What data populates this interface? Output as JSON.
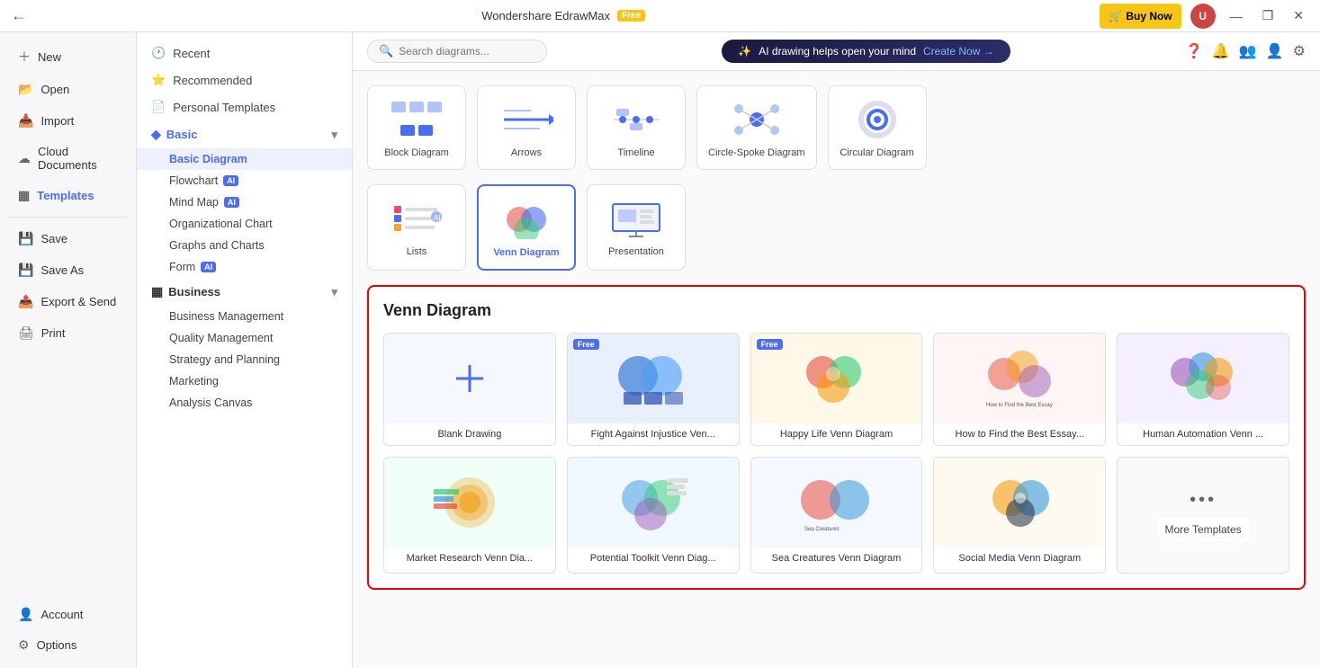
{
  "titlebar": {
    "title": "Wondershare EdrawMax",
    "badge": "Free",
    "buy_now": "Buy Now",
    "controls": [
      "—",
      "❐",
      "✕"
    ]
  },
  "sidebar": {
    "items": [
      {
        "id": "new",
        "label": "New",
        "icon": "＋"
      },
      {
        "id": "open",
        "label": "Open",
        "icon": "📂"
      },
      {
        "id": "import",
        "label": "Import",
        "icon": "📥"
      },
      {
        "id": "cloud",
        "label": "Cloud Documents",
        "icon": "☁"
      },
      {
        "id": "templates",
        "label": "Templates",
        "icon": "⬛",
        "active": true
      },
      {
        "id": "save",
        "label": "Save",
        "icon": "💾"
      },
      {
        "id": "saveas",
        "label": "Save As",
        "icon": "💾"
      },
      {
        "id": "export",
        "label": "Export & Send",
        "icon": "📤"
      },
      {
        "id": "print",
        "label": "Print",
        "icon": "🖨"
      }
    ],
    "bottom_items": [
      {
        "id": "account",
        "label": "Account",
        "icon": "👤"
      },
      {
        "id": "options",
        "label": "Options",
        "icon": "⚙"
      }
    ]
  },
  "leftnav": {
    "top_items": [
      {
        "id": "recent",
        "label": "Recent",
        "icon": "🕐"
      },
      {
        "id": "recommended",
        "label": "Recommended",
        "icon": "⭐"
      },
      {
        "id": "personal",
        "label": "Personal Templates",
        "icon": "📄"
      }
    ],
    "sections": [
      {
        "id": "basic",
        "label": "Basic",
        "active": true,
        "subs": [
          {
            "id": "basic-diagram",
            "label": "Basic Diagram",
            "active": true
          },
          {
            "id": "flowchart",
            "label": "Flowchart",
            "ai": true
          },
          {
            "id": "mindmap",
            "label": "Mind Map",
            "ai": true
          },
          {
            "id": "orgchart",
            "label": "Organizational Chart"
          },
          {
            "id": "graphs",
            "label": "Graphs and Charts"
          },
          {
            "id": "form",
            "label": "Form",
            "ai": true
          }
        ]
      },
      {
        "id": "business",
        "label": "Business",
        "active": false,
        "subs": [
          {
            "id": "business-mgmt",
            "label": "Business Management"
          },
          {
            "id": "quality",
            "label": "Quality Management"
          },
          {
            "id": "strategy",
            "label": "Strategy and Planning"
          },
          {
            "id": "marketing",
            "label": "Marketing"
          },
          {
            "id": "analysis",
            "label": "Analysis Canvas"
          }
        ]
      }
    ]
  },
  "toolbar": {
    "search_placeholder": "Search diagrams...",
    "ai_banner_text": "AI drawing helps open your mind",
    "ai_create_label": "Create Now →"
  },
  "diagram_row": [
    {
      "id": "block",
      "label": "Block Diagram"
    },
    {
      "id": "arrows",
      "label": "Arrows"
    },
    {
      "id": "timeline",
      "label": "Timeline"
    },
    {
      "id": "circlespoke",
      "label": "Circle-Spoke Diagram"
    },
    {
      "id": "circular",
      "label": "Circular Diagram"
    }
  ],
  "diagram_row2": [
    {
      "id": "lists",
      "label": "Lists"
    },
    {
      "id": "venn",
      "label": "Venn Diagram",
      "selected": true
    },
    {
      "id": "presentation",
      "label": "Presentation"
    }
  ],
  "venn_section": {
    "title": "Venn Diagram",
    "templates": [
      {
        "id": "blank",
        "label": "Blank Drawing",
        "type": "blank"
      },
      {
        "id": "fight",
        "label": "Fight Against Injustice Ven...",
        "free": true,
        "type": "fight"
      },
      {
        "id": "happy",
        "label": "Happy Life Venn Diagram",
        "free": true,
        "type": "happy"
      },
      {
        "id": "essay",
        "label": "How to Find the Best Essay...",
        "type": "essay"
      },
      {
        "id": "human",
        "label": "Human Automation Venn ...",
        "type": "human"
      },
      {
        "id": "market",
        "label": "Market Research Venn Dia...",
        "type": "market"
      },
      {
        "id": "toolkit",
        "label": "Potential Toolkit Venn Diag...",
        "type": "toolkit"
      },
      {
        "id": "seacreatures",
        "label": "Sea Creatures Venn Diagram",
        "type": "sea"
      },
      {
        "id": "social",
        "label": "Social Media Venn Diagram",
        "type": "social"
      },
      {
        "id": "more",
        "label": "More Templates",
        "type": "more"
      }
    ]
  }
}
